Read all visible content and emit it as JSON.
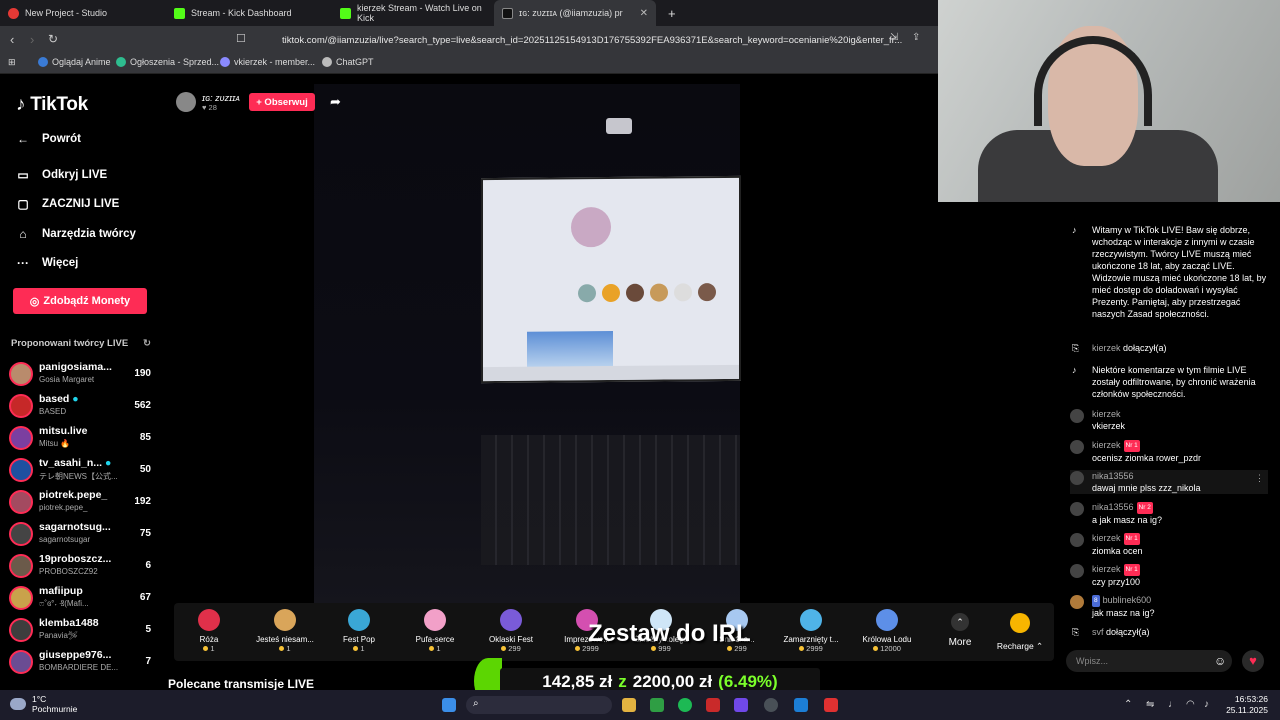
{
  "browser": {
    "tabs": [
      {
        "label": "New Project - Studio",
        "color": "#e53935"
      },
      {
        "label": "Stream - Kick Dashboard",
        "color": "#53fc18"
      },
      {
        "label": "kierzek Stream - Watch Live on Kick",
        "color": "#53fc18"
      },
      {
        "label": "ɪɢ: ᴢᴜᴢɪɪᴀ (@iiamzuzia) pr",
        "color": "#111111"
      }
    ],
    "url": "tiktok.com/@iiamzuzia/live?search_type=live&search_id=20251125154913D176755392FEA936371E&search_keyword=ocenianie%20ig&enter_fr...",
    "bookmarks": [
      "Oglądaj Anime",
      "Ogłoszenia - Sprzed...",
      "vkierzek - member...",
      "ChatGPT"
    ]
  },
  "sidebar": {
    "logo": "TikTok",
    "back": "Powrót",
    "nav": [
      {
        "label": "Odkryj LIVE",
        "icon": "live-icon"
      },
      {
        "label": "ZACZNIJ LIVE",
        "icon": "camera-icon"
      },
      {
        "label": "Narzędzia twórcy",
        "icon": "tools-icon"
      },
      {
        "label": "Więcej",
        "icon": "more-icon"
      }
    ],
    "coins_button": "Zdobądź Monety",
    "suggested_title": "Proponowani twórcy LIVE",
    "creators": [
      {
        "name": "panigosiama...",
        "sub": "Gosia Margaret",
        "count": "190",
        "color": "#b98b6c"
      },
      {
        "name": "based",
        "sub": "BASED",
        "count": "562",
        "color": "#c62828"
      },
      {
        "name": "mitsu.live",
        "sub": "Mitsu 🔥",
        "count": "85",
        "color": "#7b3fa0"
      },
      {
        "name": "tv_asahi_n...",
        "sub": "テレ朝NEWS【公式...",
        "count": "50",
        "color": "#1e50a0"
      },
      {
        "name": "piotrek.pepe_",
        "sub": "piotrek.pepe_",
        "count": "192",
        "color": "#a34a60"
      },
      {
        "name": "sagarnotsug...",
        "sub": "sagarnotsugar",
        "count": "75",
        "color": "#444444"
      },
      {
        "name": "19proboszcz...",
        "sub": "PROBOSZCZ92",
        "count": "6",
        "color": "#6b5a4a"
      },
      {
        "name": "mafiipup",
        "sub": "ෆ˚ɞ°˖ ݁Ⱐ(Mafi...",
        "count": "67",
        "color": "#c9a24b"
      },
      {
        "name": "klemba1488",
        "sub": "Panavia🛩",
        "count": "5",
        "color": "#3d3d3d"
      },
      {
        "name": "giuseppe976...",
        "sub": "BOMBARDIERE DE...",
        "count": "7",
        "color": "#6a4c93"
      }
    ]
  },
  "stream": {
    "host_name": "ɪɢ: ᴢᴜᴢɪɪᴀ",
    "host_likes": "♥ 28",
    "follow": "+ Obserwuj",
    "overlay_title": "Zestaw do IRL",
    "goal_current": "142,85 zł",
    "goal_sep": "z",
    "goal_target": "2200,00 zł",
    "goal_pct": "(6.49%)",
    "goal_progress": 0.0649,
    "section_title": "Polecane transmisje LIVE"
  },
  "gifts": [
    {
      "name": "Róża",
      "price": "1",
      "color": "#e0304a"
    },
    {
      "name": "Jesteś niesam...",
      "price": "1",
      "color": "#d9a55a"
    },
    {
      "name": "Fest Pop",
      "price": "1",
      "color": "#3aa7d6"
    },
    {
      "name": "Pufa-serce",
      "price": "1",
      "color": "#f2a0c8"
    },
    {
      "name": "Oklaski Fest",
      "price": "299",
      "color": "#7a5bd8"
    },
    {
      "name": "Imprezowe...",
      "price": "2999",
      "color": "#d44fb0"
    },
    {
      "name": "Śnieżny kolega",
      "price": "999",
      "color": "#cfe6f7"
    },
    {
      "name": "Śnieżna...",
      "price": "299",
      "color": "#a7c8f0"
    },
    {
      "name": "Zamarznięty t...",
      "price": "2999",
      "color": "#4fb3e8"
    },
    {
      "name": "Królowa Lodu",
      "price": "12000",
      "color": "#5d8fe8"
    }
  ],
  "gift_controls": {
    "more": "More",
    "recharge": "Recharge ⌃"
  },
  "chat": {
    "messages": [
      {
        "type": "system",
        "text": "Witamy w TikTok LIVE! Baw się dobrze, wchodząc w interakcje z innymi w czasie rzeczywistym. Twórcy LIVE muszą mieć ukończone 18 lat, aby zacząć LIVE. Widzowie muszą mieć ukończone 18 lat, by mieć dostęp do doładowań i wysyłać Prezenty. Pamiętaj, aby przestrzegać naszych Zasad społeczności."
      },
      {
        "type": "join",
        "user": "kierzek",
        "text": "dołączył(a)"
      },
      {
        "type": "system",
        "text": "Niektóre komentarze w tym filmie LIVE zostały odfiltrowane, by chronić wrażenia członków społeczności."
      },
      {
        "type": "comment",
        "user": "kierzek",
        "badge": "",
        "text": "vkierzek"
      },
      {
        "type": "comment",
        "user": "kierzek",
        "badge": "Nr 1",
        "text": "ocenisz ziomka rower_pzdr"
      },
      {
        "type": "comment",
        "user": "nika13556",
        "badge": "",
        "text": "dawaj mnie plss zzz_nikola"
      },
      {
        "type": "comment",
        "user": "nika13556",
        "badge": "Nr 2",
        "text": "a jak masz na ig?"
      },
      {
        "type": "comment",
        "user": "kierzek",
        "badge": "Nr 1",
        "text": "ziomka ocen"
      },
      {
        "type": "comment",
        "user": "kierzek",
        "badge": "Nr 1",
        "text": "czy przy100"
      },
      {
        "type": "comment",
        "user": "bublinek600",
        "badge": "8",
        "text": "jak masz na ig?"
      },
      {
        "type": "join",
        "user": "svf",
        "text": "dołączył(a)"
      }
    ],
    "input_placeholder": "Wpisz..."
  },
  "taskbar": {
    "temp": "1°C",
    "weather": "Pochmurnie",
    "time": "16:53:26",
    "date": "25.11.2025"
  }
}
